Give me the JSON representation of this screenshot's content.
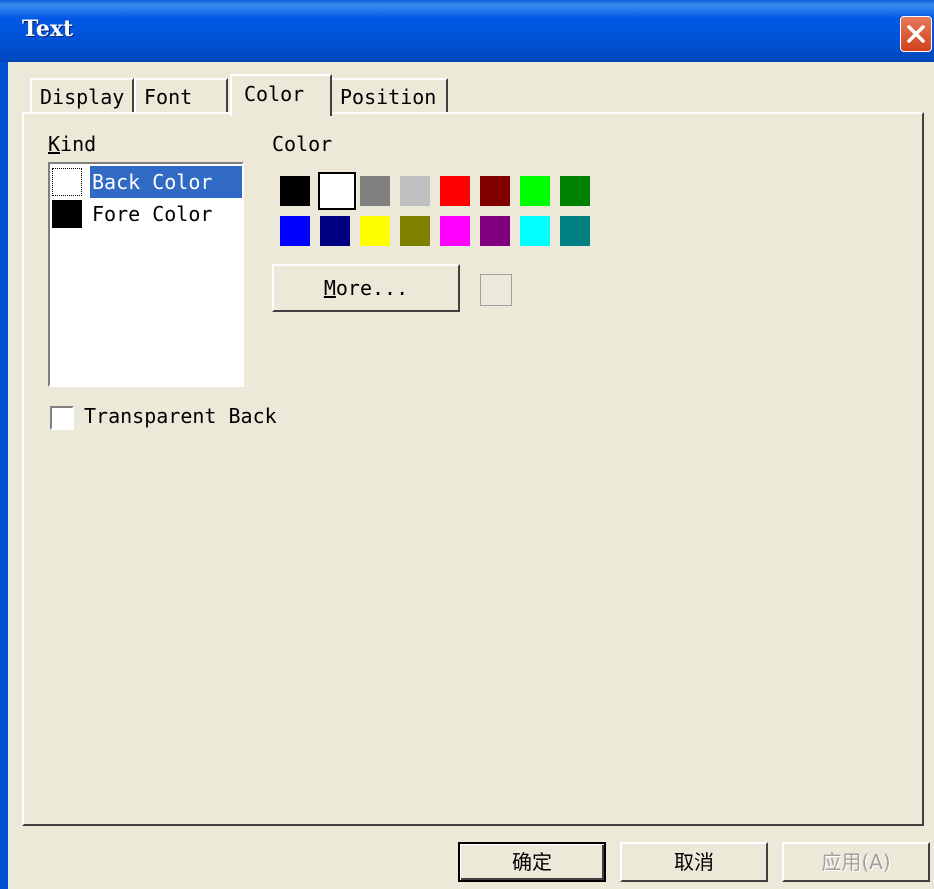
{
  "window": {
    "title": "Text"
  },
  "tabs": [
    {
      "label": "Display"
    },
    {
      "label": "Font"
    },
    {
      "label": "Color"
    },
    {
      "label": "Position"
    }
  ],
  "kind": {
    "label_first": "K",
    "label_rest": "ind",
    "items": [
      {
        "label": "Back Color",
        "swatch": "#ffffff",
        "selected": true
      },
      {
        "label": "Fore Color",
        "swatch": "#000000",
        "selected": false
      }
    ]
  },
  "color": {
    "label": "Color",
    "palette": [
      "#000000",
      "#ffffff",
      "#808080",
      "#c0c0c0",
      "#ff0000",
      "#800000",
      "#00ff00",
      "#008000",
      "#0000ff",
      "#000080",
      "#ffff00",
      "#808000",
      "#ff00ff",
      "#800080",
      "#00ffff",
      "#008080"
    ],
    "selected": "#ffffff",
    "more_first": "M",
    "more_rest": "ore...",
    "preview": "#ece9d8"
  },
  "transparent_back": {
    "label": "Transparent Back",
    "checked": false
  },
  "buttons": {
    "ok": "确定",
    "cancel": "取消",
    "apply": "应用(A)"
  }
}
